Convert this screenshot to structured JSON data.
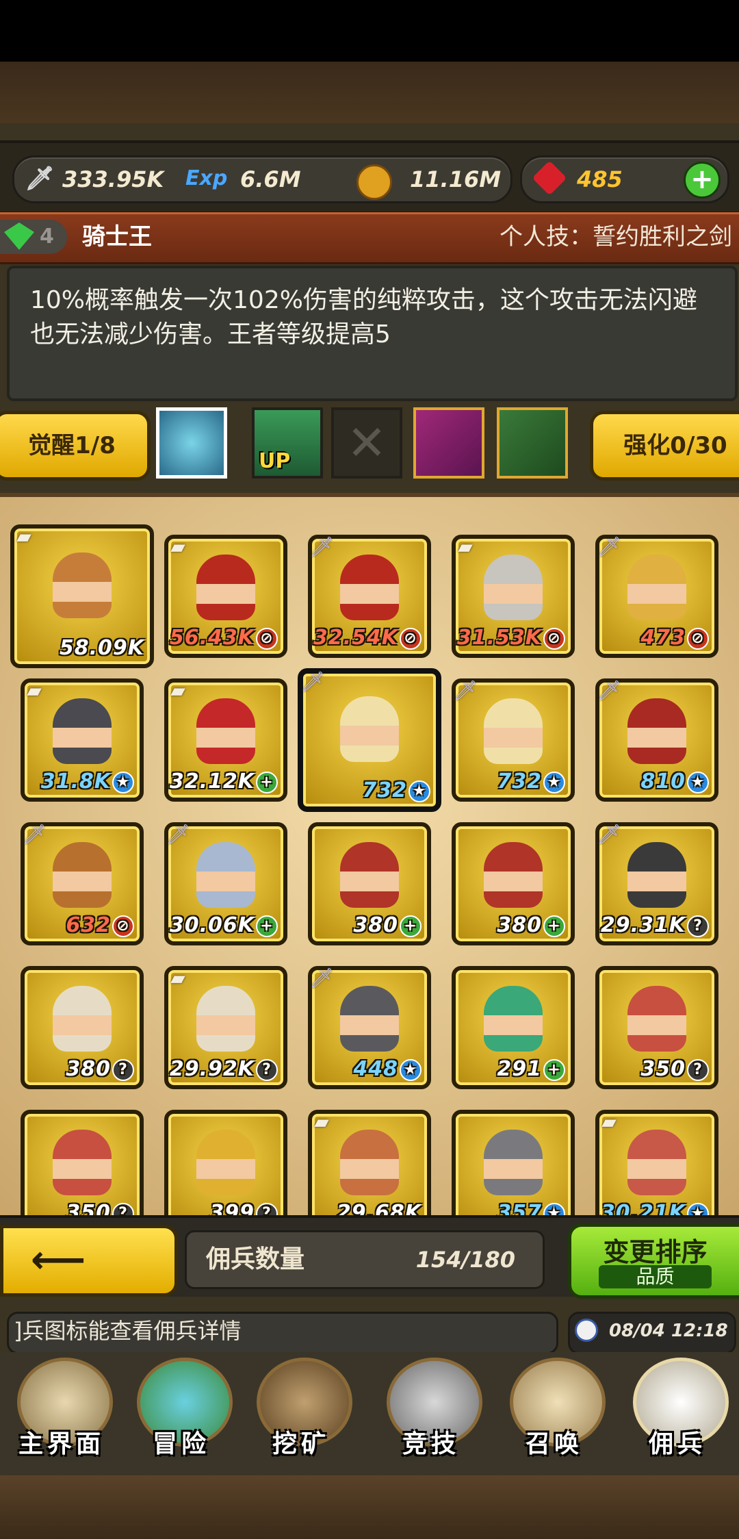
{
  "currencies": {
    "attack": "333.95K",
    "exp_label": "Exp",
    "exp": "6.6M",
    "gold": "11.16M",
    "gems": "485"
  },
  "hero": {
    "level_badge": "4",
    "name": "骑士王",
    "skill_label": "个人技：誓约胜利之剑",
    "description": "10%概率触发一次102%伤害的纯粹攻击，这个攻击无法闪避也无法减少伤害。王者等级提高5"
  },
  "buttons": {
    "awaken": "觉醒1/8",
    "enhance": "强化0/30",
    "up": "UP"
  },
  "mercenaries": [
    {
      "count": "58.09K",
      "mark": "",
      "badge": "scroll",
      "color": "#c77d3a"
    },
    {
      "count": "56.43K",
      "mark": "⊘",
      "badge": "scroll",
      "color": "#b82a1e"
    },
    {
      "count": "32.54K",
      "mark": "⊘",
      "badge": "sword",
      "color": "#b82a1e"
    },
    {
      "count": "31.53K",
      "mark": "⊘",
      "badge": "scroll",
      "color": "#c8c4be"
    },
    {
      "count": "473",
      "mark": "⊘",
      "badge": "sword",
      "color": "#e0b040"
    },
    {
      "count": "31.8K",
      "mark": "★",
      "badge": "scroll",
      "color": "#4a4a50"
    },
    {
      "count": "32.12K",
      "mark": "+",
      "badge": "scroll",
      "color": "#c42828"
    },
    {
      "count": "732",
      "mark": "★",
      "badge": "sword",
      "color": "#f0e0a8"
    },
    {
      "count": "732",
      "mark": "★",
      "badge": "sword",
      "color": "#f0e0a8"
    },
    {
      "count": "810",
      "mark": "★",
      "badge": "sword",
      "color": "#a82a22"
    },
    {
      "count": "632",
      "mark": "⊘",
      "badge": "sword",
      "color": "#b8702e"
    },
    {
      "count": "30.06K",
      "mark": "+",
      "badge": "sword",
      "color": "#a8b8d0"
    },
    {
      "count": "380",
      "mark": "+",
      "badge": "",
      "color": "#b03428"
    },
    {
      "count": "380",
      "mark": "+",
      "badge": "",
      "color": "#b03428"
    },
    {
      "count": "29.31K",
      "mark": "?",
      "badge": "sword",
      "color": "#3a3a3a"
    },
    {
      "count": "380",
      "mark": "?",
      "badge": "",
      "color": "#e6dcc6"
    },
    {
      "count": "29.92K",
      "mark": "?",
      "badge": "scroll",
      "color": "#e6dcc6"
    },
    {
      "count": "448",
      "mark": "★",
      "badge": "sword",
      "color": "#5a5a5e"
    },
    {
      "count": "291",
      "mark": "+",
      "badge": "",
      "color": "#3aa878"
    },
    {
      "count": "350",
      "mark": "?",
      "badge": "",
      "color": "#c85040"
    },
    {
      "count": "350",
      "mark": "?",
      "badge": "",
      "color": "#c85040"
    },
    {
      "count": "399",
      "mark": "?",
      "badge": "",
      "color": "#e0b030"
    },
    {
      "count": "29.68K",
      "mark": "",
      "badge": "scroll",
      "color": "#c87040"
    },
    {
      "count": "357",
      "mark": "★",
      "badge": "",
      "color": "#7a7a7e"
    },
    {
      "count": "30.21K",
      "mark": "★",
      "badge": "scroll",
      "color": "#c85848"
    }
  ],
  "bottom": {
    "count_label": "佣兵数量",
    "count_value": "154/180",
    "sort_label": "变更排序",
    "sort_mode": "品质"
  },
  "tip": {
    "text": "]兵图标能查看佣兵详情",
    "datetime": "08/04 12:18"
  },
  "nav": [
    "主界面",
    "冒险",
    "挖矿",
    "竞技",
    "召唤",
    "佣兵"
  ]
}
